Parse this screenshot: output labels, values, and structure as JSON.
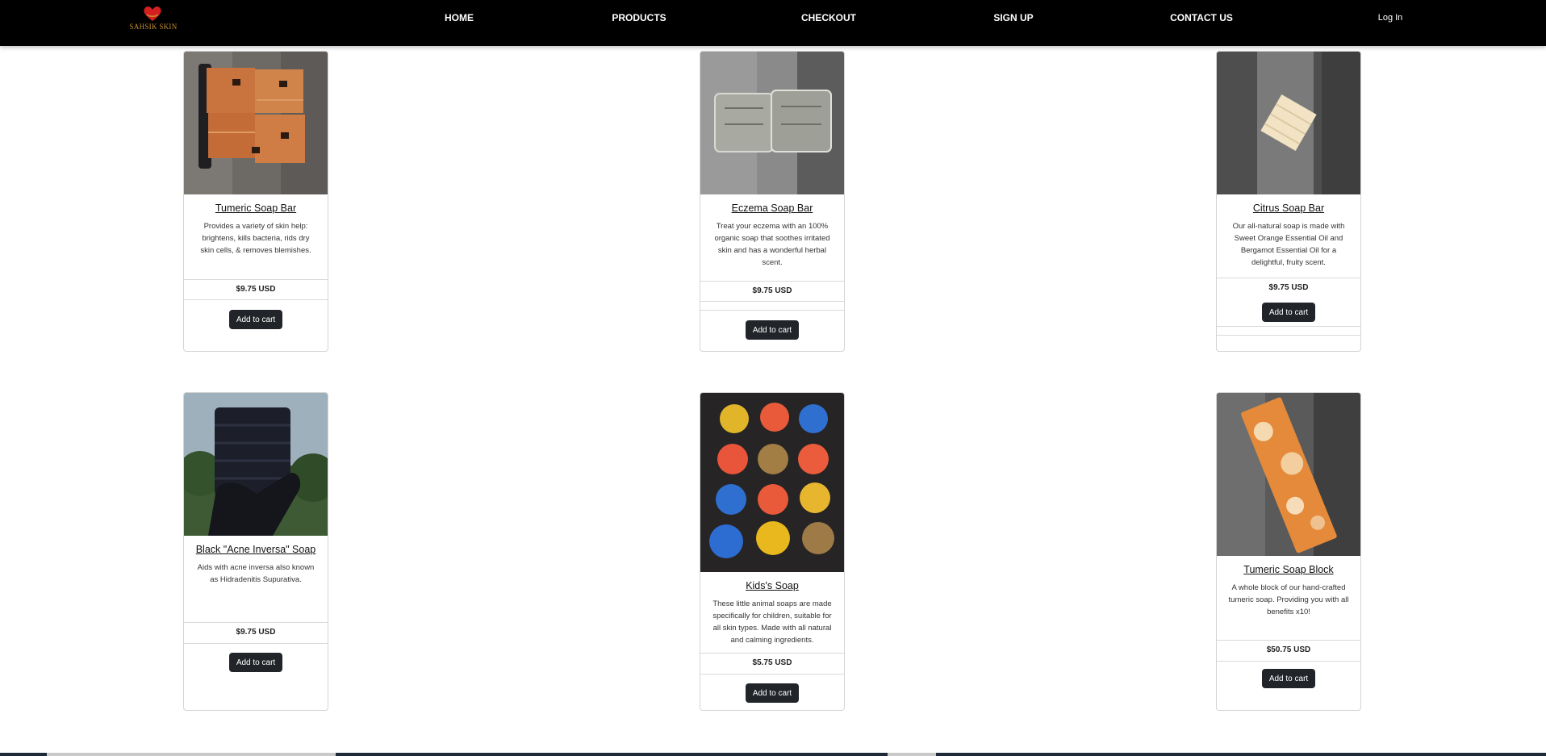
{
  "brand": {
    "logo_text": "SAHSIK SKIN"
  },
  "nav": {
    "home": "HOME",
    "products": "PRODUCTS",
    "checkout": "CHECKOUT",
    "signup": "SIGN UP",
    "contact": "CONTACT US",
    "login": "Log In"
  },
  "products": [
    {
      "title": "Tumeric Soap Bar",
      "description": "Provides a variety of skin help: brightens, kills bacteria, rids dry skin cells, & removes blemishes.",
      "price": "$9.75 USD",
      "button": "Add to cart",
      "image": "tumeric-soap-bars-photo"
    },
    {
      "title": "Eczema Soap Bar",
      "description": "Treat your eczema with an 100% organic soap that soothes irritated skin and has a wonderful herbal scent.",
      "price": "$9.75 USD",
      "button": "Add to cart",
      "image": "eczema-soap-bars-photo"
    },
    {
      "title": "Citrus Soap Bar",
      "description": "Our all-natural soap is made with Sweet Orange Essential Oil and Bergamot Essential Oil for a delightful, fruity scent.",
      "price": "$9.75 USD",
      "button": "Add to cart",
      "image": "citrus-soap-bar-photo"
    },
    {
      "title": "Black \"Acne Inversa\" Soap",
      "description": "Aids with acne inversa also known as Hidradenitis Supurativa.",
      "price": "$9.75 USD",
      "button": "Add to cart",
      "image": "black-soap-photo"
    },
    {
      "title": "Kids's Soap",
      "description": "These little animal soaps are made specifically for children, suitable for all skin types. Made with all natural and calming ingredients.",
      "price": "$5.75 USD",
      "button": "Add to cart",
      "image": "kids-animal-soaps-photo"
    },
    {
      "title": "Tumeric Soap Block",
      "description": "A whole block of our hand-crafted tumeric soap. Providing you with all benefits x10!",
      "price": "$50.75 USD",
      "button": "Add to cart",
      "image": "tumeric-soap-block-photo"
    }
  ],
  "colors": {
    "navbar": "#000000",
    "button": "#212529",
    "logo_accent": "#c8902c",
    "logo_heart": "#d42020"
  }
}
